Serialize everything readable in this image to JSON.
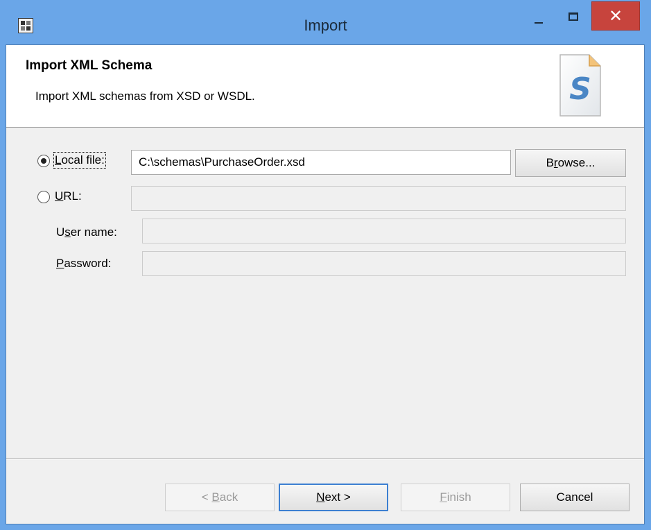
{
  "window": {
    "title": "Import",
    "close_glyph": "✕"
  },
  "banner": {
    "title": "Import XML Schema",
    "description": "Import XML schemas from XSD or WSDL.",
    "icon_letter": "S"
  },
  "source": {
    "local_file": {
      "label": "Local file:",
      "underline_char": "L",
      "rest": "ocal file:",
      "selected": true,
      "value": "C:\\schemas\\PurchaseOrder.xsd"
    },
    "url": {
      "label": "URL:",
      "underline_char": "U",
      "rest": "RL:",
      "selected": false,
      "value": ""
    },
    "browse": {
      "label": "Browse...",
      "pre": "B",
      "underline_char": "r",
      "rest": "owse..."
    },
    "user_name": {
      "label": "User name:",
      "pre": "U",
      "underline_char": "s",
      "rest": "er name:",
      "value": ""
    },
    "password": {
      "label": "Password:",
      "underline_char": "P",
      "rest": "assword:",
      "value": ""
    }
  },
  "buttons": {
    "back": {
      "pre": "< ",
      "underline_char": "B",
      "rest": "ack",
      "enabled": false
    },
    "next": {
      "underline_char": "N",
      "rest": "ext >",
      "enabled": true
    },
    "finish": {
      "underline_char": "F",
      "rest": "inish",
      "enabled": false
    },
    "cancel": {
      "label": "Cancel",
      "enabled": true
    }
  },
  "colors": {
    "titlebar": "#6aa6e8",
    "close_button": "#c7443d",
    "default_button_border": "#3c7fd1"
  }
}
